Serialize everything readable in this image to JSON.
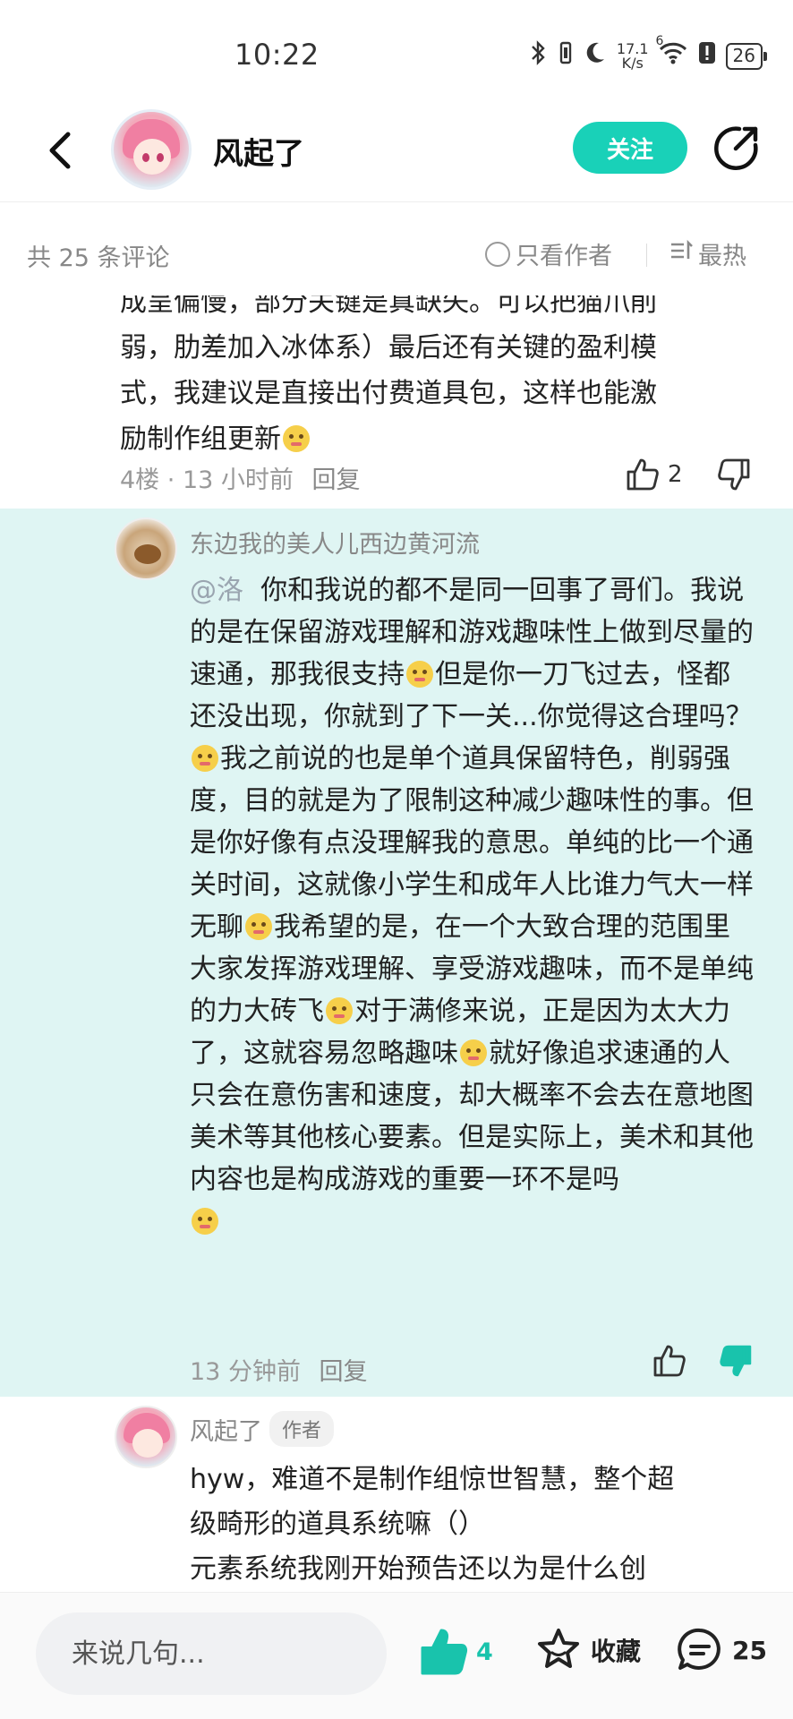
{
  "status_bar": {
    "time": "10:22",
    "net_speed_value": "17.1",
    "net_speed_unit": "K/s",
    "wifi_label": "6",
    "battery": "26"
  },
  "header": {
    "title": "风起了",
    "follow_label": "关注"
  },
  "comments_bar": {
    "count_text": "共 25 条评论",
    "author_only_label": "只看作者",
    "sort_label": "最热"
  },
  "comment_floor4": {
    "text_lines": [
      "成呈偏慢，部分关键是真缺失。可以把猫爪削",
      "弱，肋差加入冰体系）最后还有关键的盈利模",
      "式，我建议是直接出付费道具包，这样也能激",
      "励制作组更新"
    ],
    "floor": "4楼",
    "time": "13 小时前",
    "reply_label": "回复",
    "likes": "2"
  },
  "highlighted_reply": {
    "username": "东边我的美人儿西边黄河流",
    "mention": "@洛",
    "segments": [
      "你和我说的都不是同一回事了哥们。我说的是在保留游戏理解和游戏趣味性上做到尽量的速通，那我很支持",
      "但是你一刀飞过去，怪都还没出现，你就到了下一关...你觉得这合理吗？",
      "我之前说的也是单个道具保留特色，削弱强度，目的就是为了限制这种减少趣味性的事。但是你好像有点没理解我的意思。单纯的比一个通关时间，这就像小学生和成年人比谁力气大一样无聊",
      "我希望的是，在一个大致合理的范围里大家发挥游戏理解、享受游戏趣味，而不是单纯的力大砖飞",
      "对于满修来说，正是因为太大力了，这就容易忽略趣味",
      "就好像追求速通的人只会在意伤害和速度，却大概率不会去在意地图美术等其他核心要素。但是实际上，美术和其他内容也是构成游戏的重要一环不是吗"
    ],
    "time": "13 分钟前",
    "reply_label": "回复"
  },
  "author_reply": {
    "username": "风起了",
    "badge": "作者",
    "text_lines": [
      "hyw，难道不是制作组惊世智慧，整个超",
      "级畸形的道具系统嘛（）",
      "元素系统我刚开始预告还以为是什么创"
    ]
  },
  "bottom_bar": {
    "input_placeholder": "来说几句...",
    "like_count": "4",
    "collect_label": "收藏",
    "comment_count": "25"
  },
  "colors": {
    "accent": "#19d1b8",
    "highlight_bg": "#dff5f3",
    "muted_text": "#888888"
  }
}
